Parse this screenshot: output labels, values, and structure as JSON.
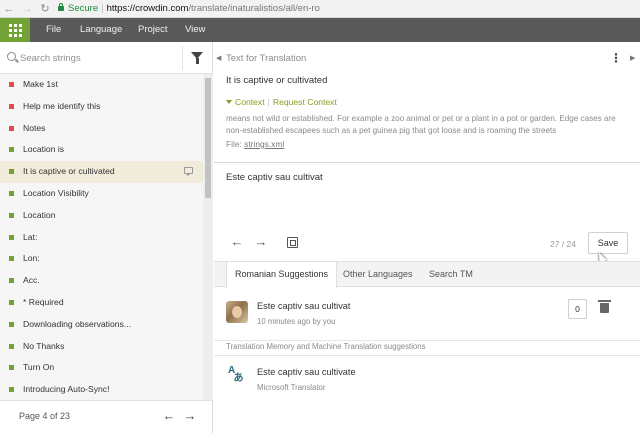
{
  "browser": {
    "secure_label": "Secure",
    "url_host": "https://crowdin.com",
    "url_path": "/translate/inaturalistios/all/en-ro"
  },
  "menu": {
    "items": [
      "File",
      "Language",
      "Project",
      "View"
    ]
  },
  "sidebar": {
    "search_placeholder": "Search strings",
    "strings": [
      {
        "label": "Make 1st",
        "status": "untranslated"
      },
      {
        "label": "Help me identify this",
        "status": "untranslated"
      },
      {
        "label": "Notes",
        "status": "untranslated"
      },
      {
        "label": "Location is",
        "status": "translated"
      },
      {
        "label": "It is captive or cultivated",
        "status": "translated",
        "active": true
      },
      {
        "label": "Location Visibility",
        "status": "translated"
      },
      {
        "label": "Location",
        "status": "translated"
      },
      {
        "label": "Lat:",
        "status": "translated"
      },
      {
        "label": "Lon:",
        "status": "translated"
      },
      {
        "label": "Acc.",
        "status": "translated"
      },
      {
        "label": "* Required",
        "status": "translated"
      },
      {
        "label": "Downloading observations...",
        "status": "translated"
      },
      {
        "label": "No Thanks",
        "status": "translated"
      },
      {
        "label": "Turn On",
        "status": "translated"
      },
      {
        "label": "Introducing Auto-Sync!",
        "status": "translated"
      }
    ],
    "page_info": "Page 4 of 23"
  },
  "source": {
    "section_label": "Text for Translation",
    "text": "It is captive or cultivated",
    "context_label": "Context",
    "request_context_label": "Request Context",
    "context_description": "means not wild or established. For example a zoo animal or pet or a plant in a pot or garden. Edge cases are non-established escapees such as a pet guinea pig that got loose and is roaming the streets",
    "file_label": "File:",
    "file_name": "strings.xml"
  },
  "editor": {
    "translation_text": "Este captiv sau cultivat",
    "char_count": "27 / 24",
    "save_label": "Save"
  },
  "tabs": [
    "Romanian Suggestions",
    "Other Languages",
    "Search TM"
  ],
  "suggestions": [
    {
      "text": "Este captiv sau cultivat",
      "meta": "10 minutes ago by you",
      "votes": "0"
    }
  ],
  "tm": {
    "header": "Translation Memory and Machine Translation suggestions",
    "items": [
      {
        "text": "Este captiv sau cultivate",
        "source": "Microsoft Translator"
      }
    ]
  },
  "colors": {
    "accent_green": "#72a236",
    "menu_bg": "#595959",
    "untranslated": "#e24b4b",
    "context_link": "#8a9b1e"
  }
}
